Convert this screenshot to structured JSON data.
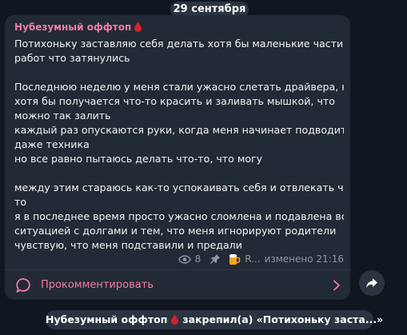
{
  "date_label": "29 сентября",
  "message": {
    "author": "Нубезумный оффтоп",
    "lines": [
      "Потихоньку заставляю себя делать хотя бы маленькие части тех",
      "работ что затянулись",
      "",
      "Последнюю неделю у меня стали ужасно слетать драйвера, но",
      "хотя бы получается что-то красить и заливать мышкой, что",
      "можно так залить",
      "каждый раз опускаются руки, когда меня начинает подводить",
      "даже  техника",
      "но все равно пытаюсь делать что-то, что могу",
      "",
      "между этим стараюсь как-то успокаивать себя и отвлекать чем-",
      "то",
      "я в последнее время просто ужасно сломлена и подавлена всей",
      "ситуацией с долгами и тем, что меня игнорируют родители",
      "чувствую, что меня подставили и предали"
    ],
    "views": "8",
    "signature": "R...",
    "edited": "изменено 21:16",
    "comments_label": "Прокомментировать"
  },
  "service": {
    "actor": "Нубезумный оффтоп",
    "action": "закрепил(а) «Потихоньку заста...»"
  },
  "colors": {
    "background": "#101720",
    "bubble": "#222a35",
    "accent": "#f07ca5",
    "drop": "#d8222a",
    "meta": "#8a96a3"
  },
  "icons": [
    "blood-drop-icon",
    "eye-icon",
    "pin-icon",
    "beer-emoji-icon",
    "comment-icon",
    "chevron-right-icon",
    "forward-icon"
  ]
}
